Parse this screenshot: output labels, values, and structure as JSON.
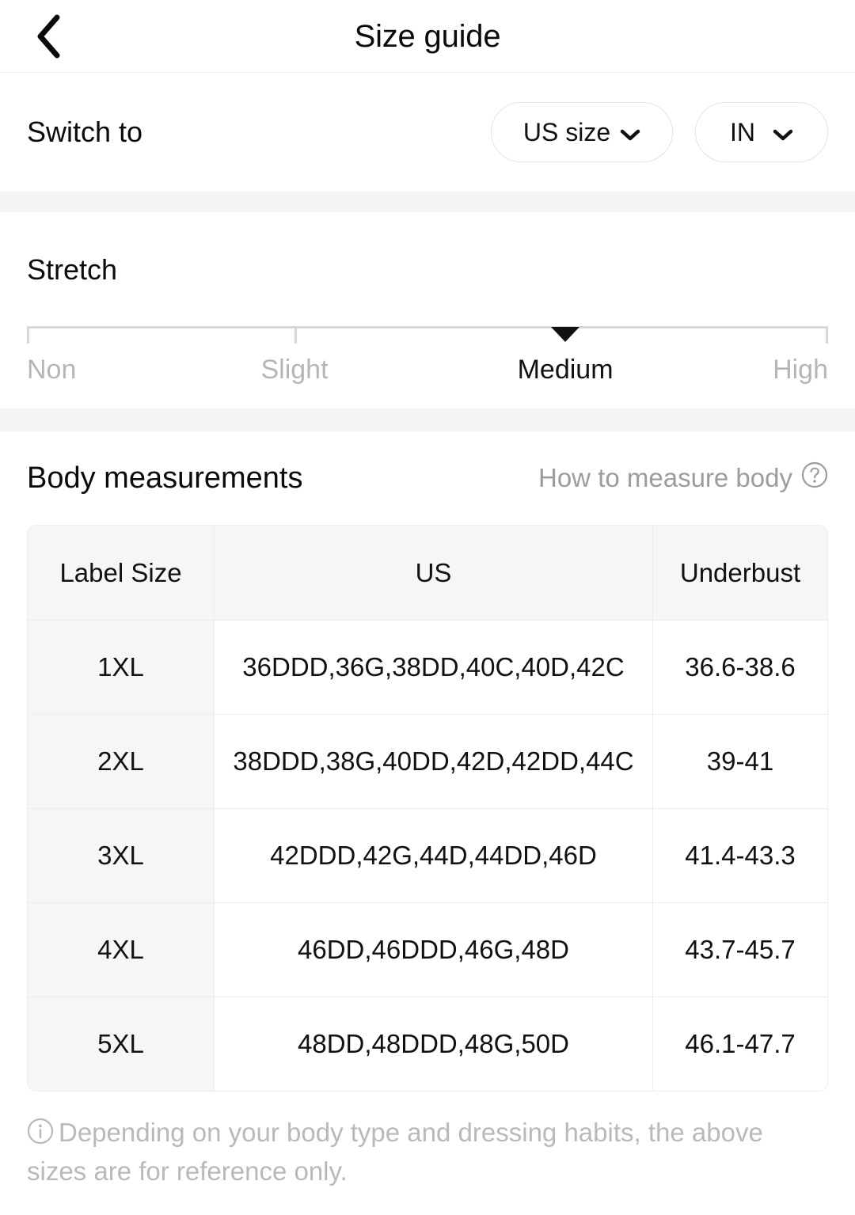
{
  "header": {
    "title": "Size guide",
    "back_icon": "chevron-left-icon"
  },
  "switch": {
    "label": "Switch to",
    "size_system": {
      "value": "US size",
      "icon": "chevron-down-icon"
    },
    "unit": {
      "value": "IN",
      "icon": "chevron-down-icon"
    }
  },
  "stretch": {
    "title": "Stretch",
    "levels": [
      "Non",
      "Slight",
      "Medium",
      "High"
    ],
    "selected": "Medium",
    "marker_icon": "triangle-down-marker"
  },
  "body_measurements": {
    "title": "Body measurements",
    "how_to_link": "How to measure body",
    "how_to_icon": "question-circle-icon",
    "table": {
      "columns": [
        "Label Size",
        "US",
        "Underbust"
      ],
      "rows": [
        {
          "label": "1XL",
          "us": "36DDD,36G,38DD,40C,40D,42C",
          "underbust": "36.6-38.6"
        },
        {
          "label": "2XL",
          "us": "38DDD,38G,40DD,42D,42DD,44C",
          "underbust": "39-41"
        },
        {
          "label": "3XL",
          "us": "42DDD,42G,44D,44DD,46D",
          "underbust": "41.4-43.3"
        },
        {
          "label": "4XL",
          "us": "46DD,46DDD,46G,48D",
          "underbust": "43.7-45.7"
        },
        {
          "label": "5XL",
          "us": "48DD,48DDD,48G,50D",
          "underbust": "46.1-47.7"
        }
      ]
    }
  },
  "footer": {
    "info_icon": "info-circle-icon",
    "note": "Depending on your body type and dressing habits, the above sizes are for reference only."
  },
  "colors": {
    "text_primary": "#111111",
    "text_muted": "#b9b9b9",
    "band": "#f5f5f5",
    "table_header_bg": "#f6f6f6",
    "border": "#ededed"
  }
}
